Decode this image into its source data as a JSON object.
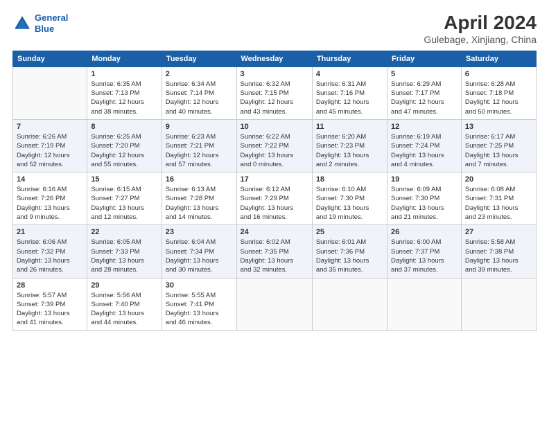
{
  "header": {
    "logo_line1": "General",
    "logo_line2": "Blue",
    "title": "April 2024",
    "subtitle": "Gulebage, Xinjiang, China"
  },
  "days_of_week": [
    "Sunday",
    "Monday",
    "Tuesday",
    "Wednesday",
    "Thursday",
    "Friday",
    "Saturday"
  ],
  "weeks": [
    [
      {
        "day": "",
        "info": ""
      },
      {
        "day": "1",
        "info": "Sunrise: 6:35 AM\nSunset: 7:13 PM\nDaylight: 12 hours\nand 38 minutes."
      },
      {
        "day": "2",
        "info": "Sunrise: 6:34 AM\nSunset: 7:14 PM\nDaylight: 12 hours\nand 40 minutes."
      },
      {
        "day": "3",
        "info": "Sunrise: 6:32 AM\nSunset: 7:15 PM\nDaylight: 12 hours\nand 43 minutes."
      },
      {
        "day": "4",
        "info": "Sunrise: 6:31 AM\nSunset: 7:16 PM\nDaylight: 12 hours\nand 45 minutes."
      },
      {
        "day": "5",
        "info": "Sunrise: 6:29 AM\nSunset: 7:17 PM\nDaylight: 12 hours\nand 47 minutes."
      },
      {
        "day": "6",
        "info": "Sunrise: 6:28 AM\nSunset: 7:18 PM\nDaylight: 12 hours\nand 50 minutes."
      }
    ],
    [
      {
        "day": "7",
        "info": "Sunrise: 6:26 AM\nSunset: 7:19 PM\nDaylight: 12 hours\nand 52 minutes."
      },
      {
        "day": "8",
        "info": "Sunrise: 6:25 AM\nSunset: 7:20 PM\nDaylight: 12 hours\nand 55 minutes."
      },
      {
        "day": "9",
        "info": "Sunrise: 6:23 AM\nSunset: 7:21 PM\nDaylight: 12 hours\nand 57 minutes."
      },
      {
        "day": "10",
        "info": "Sunrise: 6:22 AM\nSunset: 7:22 PM\nDaylight: 13 hours\nand 0 minutes."
      },
      {
        "day": "11",
        "info": "Sunrise: 6:20 AM\nSunset: 7:23 PM\nDaylight: 13 hours\nand 2 minutes."
      },
      {
        "day": "12",
        "info": "Sunrise: 6:19 AM\nSunset: 7:24 PM\nDaylight: 13 hours\nand 4 minutes."
      },
      {
        "day": "13",
        "info": "Sunrise: 6:17 AM\nSunset: 7:25 PM\nDaylight: 13 hours\nand 7 minutes."
      }
    ],
    [
      {
        "day": "14",
        "info": "Sunrise: 6:16 AM\nSunset: 7:26 PM\nDaylight: 13 hours\nand 9 minutes."
      },
      {
        "day": "15",
        "info": "Sunrise: 6:15 AM\nSunset: 7:27 PM\nDaylight: 13 hours\nand 12 minutes."
      },
      {
        "day": "16",
        "info": "Sunrise: 6:13 AM\nSunset: 7:28 PM\nDaylight: 13 hours\nand 14 minutes."
      },
      {
        "day": "17",
        "info": "Sunrise: 6:12 AM\nSunset: 7:29 PM\nDaylight: 13 hours\nand 16 minutes."
      },
      {
        "day": "18",
        "info": "Sunrise: 6:10 AM\nSunset: 7:30 PM\nDaylight: 13 hours\nand 19 minutes."
      },
      {
        "day": "19",
        "info": "Sunrise: 6:09 AM\nSunset: 7:30 PM\nDaylight: 13 hours\nand 21 minutes."
      },
      {
        "day": "20",
        "info": "Sunrise: 6:08 AM\nSunset: 7:31 PM\nDaylight: 13 hours\nand 23 minutes."
      }
    ],
    [
      {
        "day": "21",
        "info": "Sunrise: 6:06 AM\nSunset: 7:32 PM\nDaylight: 13 hours\nand 26 minutes."
      },
      {
        "day": "22",
        "info": "Sunrise: 6:05 AM\nSunset: 7:33 PM\nDaylight: 13 hours\nand 28 minutes."
      },
      {
        "day": "23",
        "info": "Sunrise: 6:04 AM\nSunset: 7:34 PM\nDaylight: 13 hours\nand 30 minutes."
      },
      {
        "day": "24",
        "info": "Sunrise: 6:02 AM\nSunset: 7:35 PM\nDaylight: 13 hours\nand 32 minutes."
      },
      {
        "day": "25",
        "info": "Sunrise: 6:01 AM\nSunset: 7:36 PM\nDaylight: 13 hours\nand 35 minutes."
      },
      {
        "day": "26",
        "info": "Sunrise: 6:00 AM\nSunset: 7:37 PM\nDaylight: 13 hours\nand 37 minutes."
      },
      {
        "day": "27",
        "info": "Sunrise: 5:58 AM\nSunset: 7:38 PM\nDaylight: 13 hours\nand 39 minutes."
      }
    ],
    [
      {
        "day": "28",
        "info": "Sunrise: 5:57 AM\nSunset: 7:39 PM\nDaylight: 13 hours\nand 41 minutes."
      },
      {
        "day": "29",
        "info": "Sunrise: 5:56 AM\nSunset: 7:40 PM\nDaylight: 13 hours\nand 44 minutes."
      },
      {
        "day": "30",
        "info": "Sunrise: 5:55 AM\nSunset: 7:41 PM\nDaylight: 13 hours\nand 46 minutes."
      },
      {
        "day": "",
        "info": ""
      },
      {
        "day": "",
        "info": ""
      },
      {
        "day": "",
        "info": ""
      },
      {
        "day": "",
        "info": ""
      }
    ]
  ]
}
